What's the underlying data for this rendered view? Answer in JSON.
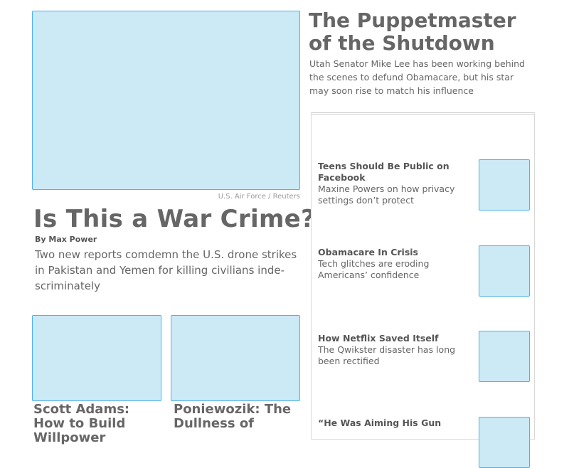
{
  "hero": {
    "credit": "U.S. Air Force / Reuters",
    "title": "Is This a War Crime?",
    "byline": "By Max Power",
    "summary": "Two new reports comdemn the U.S. drone strikes in Pakistan and Yemen for killing civilians inde-scriminately"
  },
  "cards": [
    {
      "title": "Scott Adams: How to Build Willpower"
    },
    {
      "title": "Poniewozik: The Dullness of"
    }
  ],
  "feature": {
    "title": "The Puppetmaster of the Shutdown",
    "summary": "Utah Senator Mike Lee has been working behind the scenes to defund Obamacare, but his star may soon rise to match his influence"
  },
  "sidebar": {
    "items": [
      {
        "title": "Teens Should Be Public on Facebook",
        "desc": "Maxine Powers on how privacy settings don’t protect"
      },
      {
        "title": "Obamacare In Crisis",
        "desc": "Tech glitches are eroding Americans’ confidence"
      },
      {
        "title": "How Netflix Saved Itself",
        "desc": "The Qwikster disaster has long been rectified"
      },
      {
        "title": "“He Was Aiming His Gun",
        "desc": ""
      }
    ]
  },
  "colors": {
    "placeholder_fill": "#cce9f6",
    "placeholder_border": "#4fb3e4",
    "text": "#666666"
  }
}
